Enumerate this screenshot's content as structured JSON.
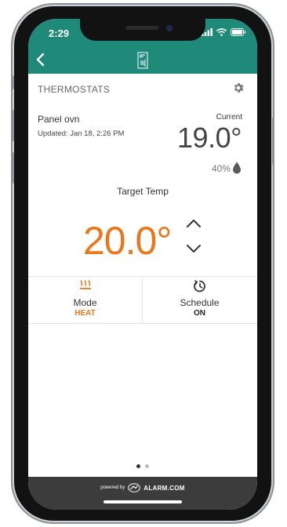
{
  "status_bar": {
    "time": "2:29"
  },
  "section": {
    "title": "THERMOSTATS"
  },
  "device": {
    "name": "Panel ovn",
    "updated": "Updated: Jan 18, 2:26 PM",
    "current_label": "Current",
    "current_temp": "19.0°",
    "humidity": "40%"
  },
  "target": {
    "label": "Target Temp",
    "temp": "20.0°"
  },
  "mode": {
    "label": "Mode",
    "value": "HEAT"
  },
  "schedule": {
    "label": "Schedule",
    "value": "ON"
  },
  "pager": {
    "pages": 2,
    "active": 1
  },
  "footer": {
    "powered_by": "powered by",
    "brand": "ALARM.COM"
  },
  "colors": {
    "header_teal": "#1f8a79",
    "accent_orange": "#e9781d",
    "footer_dark": "#3c3c3c"
  },
  "icons": {
    "back": "chevron-left-icon",
    "logo": "logo-icon",
    "settings": "gear-icon",
    "humidity": "water-drop-icon",
    "increase": "chevron-up-icon",
    "decrease": "chevron-down-icon",
    "mode": "heat-icon",
    "schedule": "schedule-icon"
  }
}
